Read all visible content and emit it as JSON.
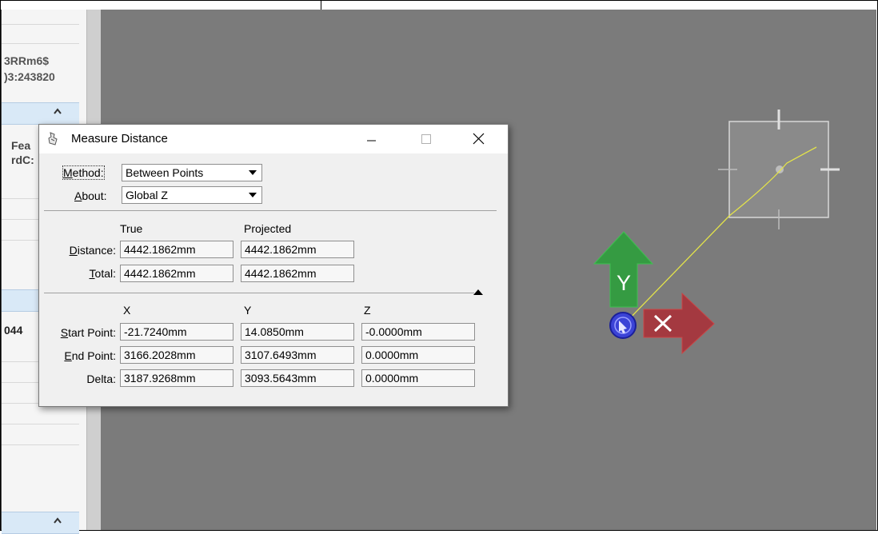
{
  "left_panel": {
    "line1": "3RRm6$",
    "line2": ")3:243820",
    "item_fea": "Fea",
    "item_rdc": "rdC:",
    "item_044": "044"
  },
  "dialog": {
    "title": "Measure Distance",
    "method": {
      "label_u": "M",
      "label_rest": "ethod:",
      "value": "Between Points"
    },
    "about": {
      "label_u": "A",
      "label_rest": "bout:",
      "value": "Global Z"
    },
    "headers": {
      "true": "True",
      "projected": "Projected"
    },
    "distance": {
      "label_u": "D",
      "label_rest": "istance:",
      "true": "4442.1862mm",
      "projected": "4442.1862mm"
    },
    "total": {
      "label_u": "T",
      "label_rest": "otal:",
      "true": "4442.1862mm",
      "projected": "4442.1862mm"
    },
    "coord_headers": {
      "x": "X",
      "y": "Y",
      "z": "Z"
    },
    "start_point": {
      "label_u": "S",
      "label_rest": "tart Point:",
      "x": "-21.7240mm",
      "y": "14.0850mm",
      "z": "-0.0000mm"
    },
    "end_point": {
      "label_u": "E",
      "label_rest": "nd Point:",
      "x": "3166.2028mm",
      "y": "3107.6493mm",
      "z": "0.0000mm"
    },
    "delta": {
      "label": "Delta:",
      "x": "3187.9268mm",
      "y": "3093.5643mm",
      "z": "0.0000mm"
    }
  },
  "viewport": {
    "background": "#7b7b7b",
    "axis_y_label": "Y",
    "axis_y_color": "#2e9e3c",
    "axis_x_color": "#a8323a",
    "measure_line_color": "#e3e34a",
    "icons": [
      "cursor-box-icon",
      "axis-triad-icon",
      "snap-point-icon"
    ]
  }
}
